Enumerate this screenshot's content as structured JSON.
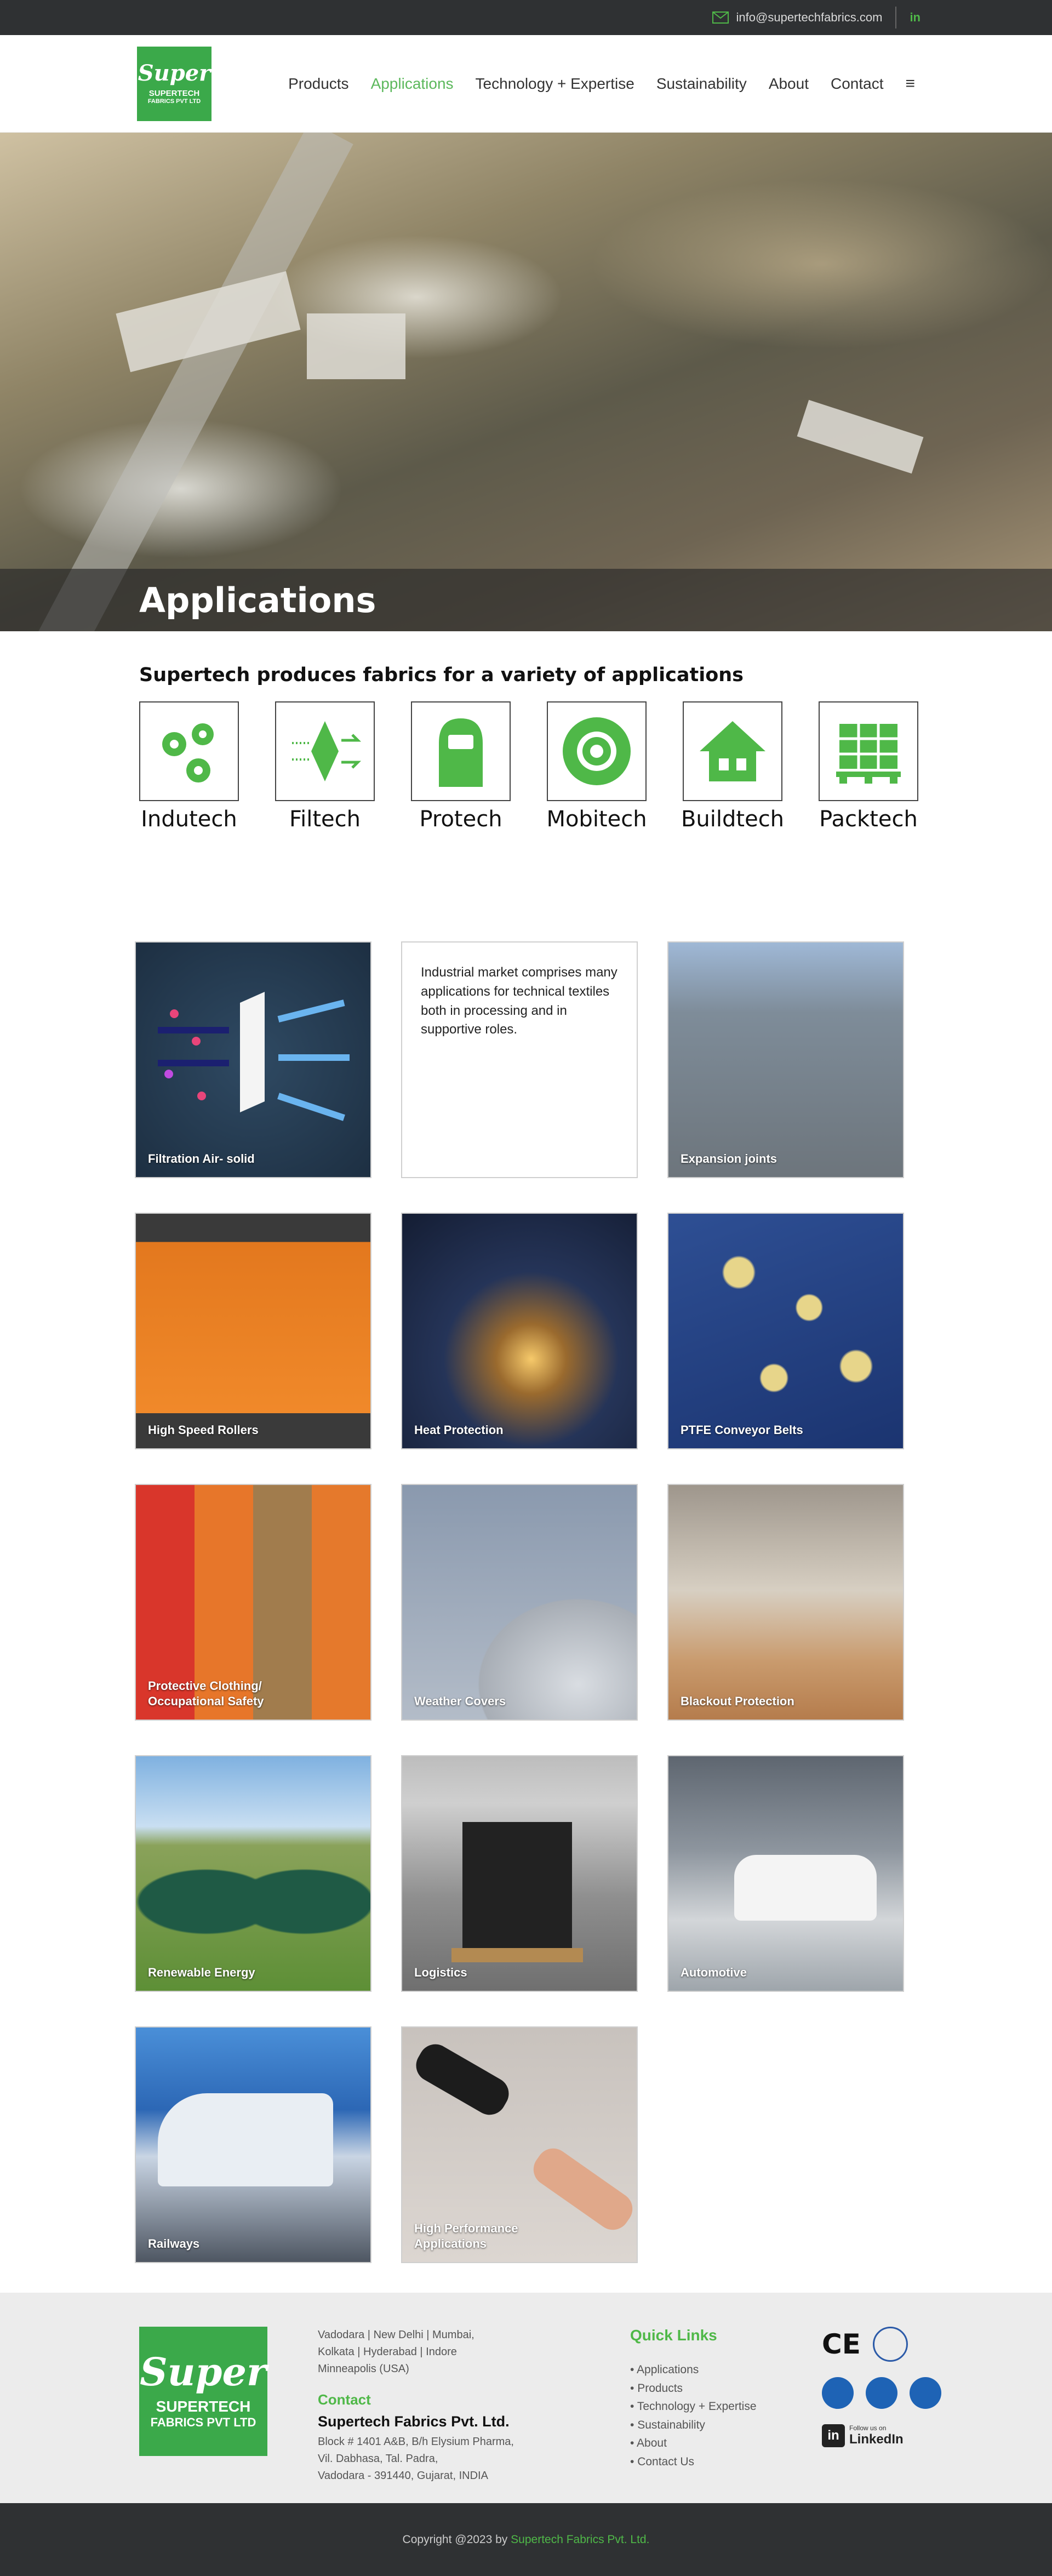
{
  "topbar": {
    "email": "info@supertechfabrics.com",
    "linkedin_icon": "in"
  },
  "logo": {
    "script": "Super",
    "line1": "SUPERTECH",
    "line2": "FABRICS PVT LTD"
  },
  "nav": [
    {
      "label": "Products",
      "active": false
    },
    {
      "label": "Applications",
      "active": true
    },
    {
      "label": "Technology + Expertise",
      "active": false
    },
    {
      "label": "Sustainability",
      "active": false
    },
    {
      "label": "About",
      "active": false
    },
    {
      "label": "Contact",
      "active": false
    }
  ],
  "hero": {
    "title": "Applications"
  },
  "intro": {
    "heading": "Supertech produces fabrics for a variety of applications"
  },
  "categories": [
    {
      "label": "Indutech",
      "icon": "gears-icon"
    },
    {
      "label": "Filtech",
      "icon": "filter-icon"
    },
    {
      "label": "Protech",
      "icon": "protective-hood-icon"
    },
    {
      "label": "Mobitech",
      "icon": "wheel-icon"
    },
    {
      "label": "Buildtech",
      "icon": "house-icon"
    },
    {
      "label": "Packtech",
      "icon": "pallet-icon"
    }
  ],
  "tiles": [
    {
      "caption": "Filtration Air- solid"
    },
    {
      "text": "Industrial market comprises many applications for technical textiles both in processing and in supportive roles."
    },
    {
      "caption": "Expansion joints"
    },
    {
      "caption": "High Speed Rollers"
    },
    {
      "caption": "Heat Protection"
    },
    {
      "caption": "PTFE Conveyor Belts"
    },
    {
      "caption": "Protective Clothing/ Occupational Safety"
    },
    {
      "caption": "Weather Covers"
    },
    {
      "caption": "Blackout  Protection"
    },
    {
      "caption": "Renewable Energy"
    },
    {
      "caption": "Logistics"
    },
    {
      "caption": "Automotive"
    },
    {
      "caption": "Railways"
    },
    {
      "caption": "High Performance Applications"
    }
  ],
  "footer": {
    "logo": {
      "script": "Super",
      "line1": "SUPERTECH",
      "line2": "FABRICS PVT LTD"
    },
    "cities": [
      "Vadodara | New Delhi | Mumbai,",
      "Kolkata | Hyderabad | Indore",
      "Minneapolis (USA)"
    ],
    "contact_heading": "Contact",
    "company": "Supertech Fabrics Pvt. Ltd.",
    "address": [
      "Block # 1401 A&B, B/h Elysium Pharma,",
      "Vil. Dabhasa, Tal. Padra,",
      "Vadodara - 391440, Gujarat, INDIA"
    ],
    "quick_links_heading": "Quick Links",
    "quick_links": [
      "Applications",
      "Products",
      "Technology + Expertise",
      "Sustainability",
      "About",
      "Contact Us"
    ],
    "linkedin": {
      "small": "Follow us on",
      "big": "LinkedIn",
      "icon": "in"
    }
  },
  "copyright": {
    "prefix": "Copyright @2023 by",
    "company": "Supertech Fabrics Pvt. Ltd."
  }
}
